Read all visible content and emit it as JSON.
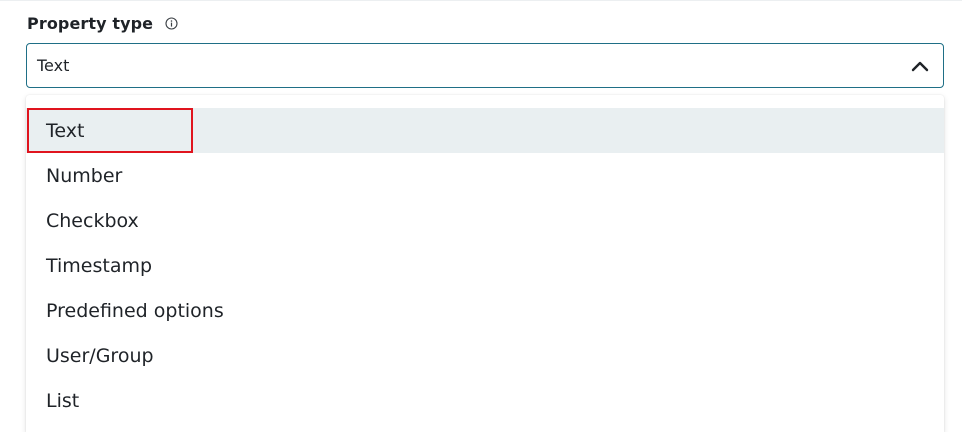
{
  "field": {
    "label": "Property type",
    "info_icon": "info-icon"
  },
  "select": {
    "value": "Text",
    "chevron_icon": "chevron-up-icon",
    "accent_color": "#1f6f86"
  },
  "dropdown": {
    "options": [
      {
        "label": "Text",
        "selected": true
      },
      {
        "label": "Number",
        "selected": false
      },
      {
        "label": "Checkbox",
        "selected": false
      },
      {
        "label": "Timestamp",
        "selected": false
      },
      {
        "label": "Predefined options",
        "selected": false
      },
      {
        "label": "User/Group",
        "selected": false
      },
      {
        "label": "List",
        "selected": false
      }
    ],
    "selected_bg": "#e9eff1",
    "highlight_color": "#e0141e"
  }
}
